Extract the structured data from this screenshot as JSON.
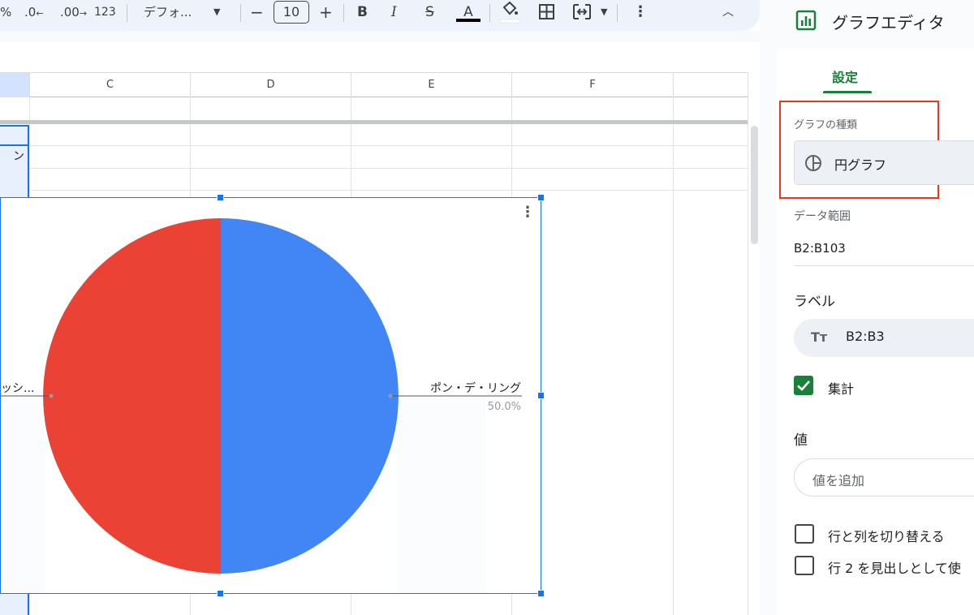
{
  "toolbar": {
    "percent_label": "%",
    "decimal_decrease_label": ".0",
    "decimal_increase_label": ".00",
    "number_format_label": "123",
    "font_name": "デフォ...",
    "font_size_minus": "−",
    "font_size": "10",
    "font_size_plus": "+",
    "bold_label": "B",
    "italic_label": "I",
    "strikethrough_label": "S",
    "text_color_label": "A"
  },
  "sheet": {
    "columns": [
      "C",
      "D",
      "E",
      "F"
    ],
    "row_cell_text": "ン"
  },
  "chart": {
    "menu_icon": "more-vertical-icon",
    "right_label": "ポン・デ・リング",
    "right_percent": "50.0%",
    "left_label": "ッシ..."
  },
  "chart_data": {
    "type": "pie",
    "categories": [
      "ポン・デ・リング",
      ""
    ],
    "values": [
      50.0,
      50.0
    ],
    "colors": [
      "#4285f4",
      "#ea4335"
    ]
  },
  "editor": {
    "title": "グラフエディタ",
    "tab_settings": "設定",
    "chart_type_label": "グラフの種類",
    "chart_type_value": "円グラフ",
    "data_range_label": "データ範囲",
    "data_range_value": "B2:B103",
    "label_section": "ラベル",
    "label_range": "B2:B3",
    "aggregate_label": "集計",
    "value_section": "値",
    "add_value_placeholder": "値を追加",
    "switch_rows_cols": "行と列を切り替える",
    "use_row_as_header": "行 2 を見出しとして使",
    "accent_color": "#188038",
    "highlight_color": "#e8381e"
  }
}
